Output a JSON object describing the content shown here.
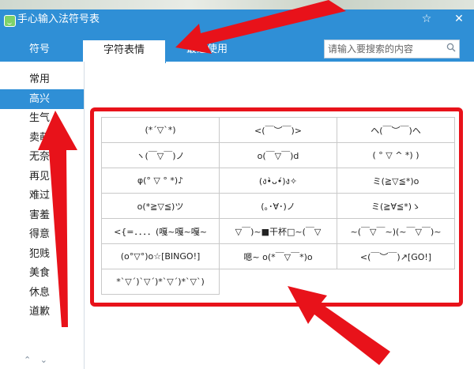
{
  "window": {
    "title": "手心输入法符号表",
    "pin_icon": "pin-icon",
    "close_icon": "close-icon"
  },
  "tabs": [
    {
      "label": "符号"
    },
    {
      "label": "字符表情"
    },
    {
      "label": "最近使用"
    }
  ],
  "search": {
    "placeholder": "请输入要搜索的内容"
  },
  "sidebar": {
    "items": [
      {
        "label": "常用"
      },
      {
        "label": "高兴"
      },
      {
        "label": "生气"
      },
      {
        "label": "卖萌"
      },
      {
        "label": "无奈"
      },
      {
        "label": "再见"
      },
      {
        "label": "难过"
      },
      {
        "label": "害羞"
      },
      {
        "label": "得意"
      },
      {
        "label": "犯贱"
      },
      {
        "label": "美食"
      },
      {
        "label": "休息"
      },
      {
        "label": "道歉"
      }
    ],
    "scroll_up": "⌃",
    "scroll_down": "⌄"
  },
  "emoticons": [
    [
      "(*´▽`*)",
      "<(￣︶￣)>",
      "ヘ(￣︶￣)ヘ"
    ],
    [
      "ヽ(￣▽￣)ノ",
      "o(￣▽￣)d",
      "( ° ▽ ^ *) )"
    ],
    [
      "φ(° ▽ ° *)♪",
      "(ง•̀ᴗ•́)ง✧",
      "ミ(≧▽≦*)o"
    ],
    [
      "o(*≧▽≦)ツ",
      "(｡･∀･)ノ",
      "ミ(≧∀≦*)ゝ"
    ],
    [
      "<{=．．．．(嘎~嘎~嘎~",
      "▽￣)~■干杯□~(￣▽",
      "~(￣▽￣~)(~￣▽￣)~"
    ],
    [
      "(o°▽°)o☆[BINGO!]",
      "嗯~ o(*￣▽￣*)o",
      "<(￣︶￣)↗[GO!]"
    ],
    [
      "*ˋ▽ˊ)ˋ▽ˊ)*ˋ▽ˊ)*ˋ▽ˋ)",
      "",
      ""
    ]
  ],
  "colors": {
    "accent": "#2f8fd6",
    "annotation": "#e8121a"
  }
}
